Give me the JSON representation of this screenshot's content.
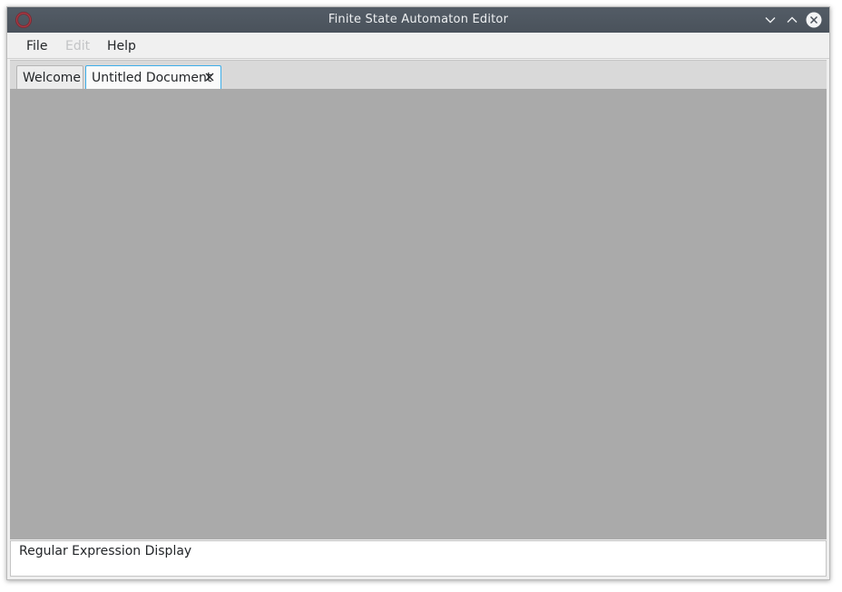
{
  "window": {
    "title": "Finite State Automaton Editor",
    "icon": "app-ring-icon",
    "controls": [
      "minimize-icon",
      "maximize-icon",
      "close-icon"
    ]
  },
  "menubar": {
    "file": "File",
    "edit": "Edit",
    "help": "Help"
  },
  "tabs": [
    {
      "label": "Welcome",
      "active": false
    },
    {
      "label": "Untitled Document",
      "active": true,
      "closable": true
    }
  ],
  "regex_display": {
    "text": "Regular Expression Display"
  },
  "colors": {
    "titlebar": "#4f5760",
    "canvas": "#aaaaaa",
    "active_tab_border": "#3daee9",
    "disabled_text": "#c3c4c6"
  }
}
